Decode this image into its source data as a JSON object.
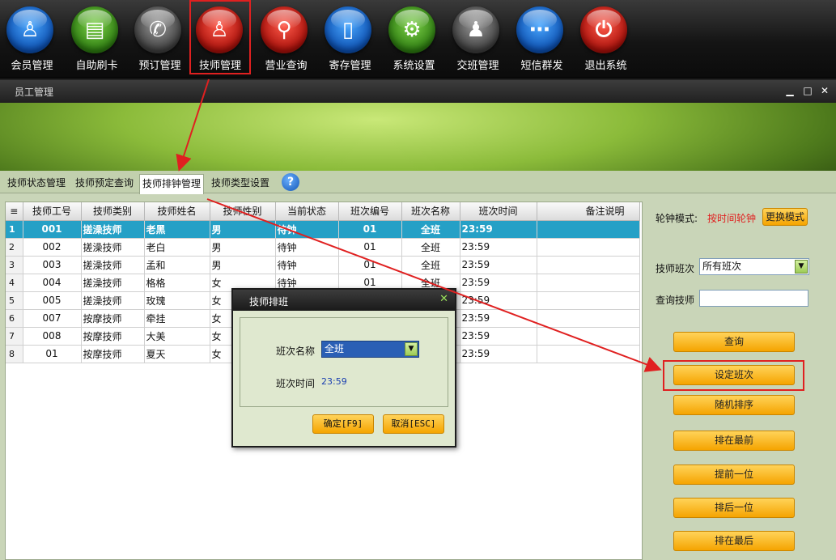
{
  "toolbar": {
    "items": [
      {
        "label": "会员管理",
        "icon": "member-icon"
      },
      {
        "label": "自助刷卡",
        "icon": "card-icon"
      },
      {
        "label": "预订管理",
        "icon": "phone-icon"
      },
      {
        "label": "技师管理",
        "icon": "technician-icon"
      },
      {
        "label": "营业查询",
        "icon": "search-icon"
      },
      {
        "label": "寄存管理",
        "icon": "bag-icon"
      },
      {
        "label": "系统设置",
        "icon": "gear-icon"
      },
      {
        "label": "交班管理",
        "icon": "shift-icon"
      },
      {
        "label": "短信群发",
        "icon": "sms-icon"
      },
      {
        "label": "退出系统",
        "icon": "power-icon"
      }
    ]
  },
  "window": {
    "title": "员工管理",
    "min_symbol": "▁",
    "max_symbol": "□",
    "close_symbol": "✕"
  },
  "tabs": [
    "技师状态管理",
    "技师预定查询",
    "技师排钟管理",
    "技师类型设置"
  ],
  "help_symbol": "?",
  "grid": {
    "columns": [
      "技师工号",
      "技师类别",
      "技师姓名",
      "技师性别",
      "当前状态",
      "班次编号",
      "班次名称",
      "班次时间",
      "备注说明"
    ],
    "rows": [
      {
        "n": "1",
        "id": "001",
        "type": "搓澡技师",
        "name": "老黑",
        "gender": "男",
        "status": "待钟",
        "shift_no": "01",
        "shift_name": "全班",
        "time": "23:59",
        "note": ""
      },
      {
        "n": "2",
        "id": "002",
        "type": "搓澡技师",
        "name": "老白",
        "gender": "男",
        "status": "待钟",
        "shift_no": "01",
        "shift_name": "全班",
        "time": "23:59",
        "note": ""
      },
      {
        "n": "3",
        "id": "003",
        "type": "搓澡技师",
        "name": "孟和",
        "gender": "男",
        "status": "待钟",
        "shift_no": "01",
        "shift_name": "全班",
        "time": "23:59",
        "note": ""
      },
      {
        "n": "4",
        "id": "004",
        "type": "搓澡技师",
        "name": "格格",
        "gender": "女",
        "status": "待钟",
        "shift_no": "01",
        "shift_name": "全班",
        "time": "23:59",
        "note": ""
      },
      {
        "n": "5",
        "id": "005",
        "type": "搓澡技师",
        "name": "玫瑰",
        "gender": "女",
        "status": "",
        "shift_no": "",
        "shift_name": "",
        "time": "23:59",
        "note": ""
      },
      {
        "n": "6",
        "id": "007",
        "type": "按摩技师",
        "name": "牵挂",
        "gender": "女",
        "status": "",
        "shift_no": "",
        "shift_name": "",
        "time": "23:59",
        "note": ""
      },
      {
        "n": "7",
        "id": "008",
        "type": "按摩技师",
        "name": "大美",
        "gender": "女",
        "status": "",
        "shift_no": "",
        "shift_name": "",
        "time": "23:59",
        "note": ""
      },
      {
        "n": "8",
        "id": "01",
        "type": "按摩技师",
        "name": "夏天",
        "gender": "女",
        "status": "",
        "shift_no": "",
        "shift_name": "",
        "time": "23:59",
        "note": ""
      }
    ]
  },
  "right_panel": {
    "mode_label": "轮钟模式:",
    "mode_value": "按时间轮钟",
    "change_mode": "更换模式",
    "shift_label": "技师班次",
    "shift_value": "所有班次",
    "query_label": "查询技师",
    "query_value": "",
    "buttons": [
      "查询",
      "设定班次",
      "随机排序",
      "排在最前",
      "提前一位",
      "排后一位",
      "排在最后"
    ]
  },
  "dialog": {
    "title": "技师排班",
    "close_symbol": "✕",
    "name_label": "班次名称",
    "name_value": "全班",
    "time_label": "班次时间",
    "time_value": "23:59",
    "ok": "确定[F9]",
    "cancel": "取消[ESC]"
  },
  "colors": {
    "selected_row": "#25a0c6",
    "button": "#f5a400",
    "highlight": "#e02020",
    "mode_value": "#e02020"
  }
}
